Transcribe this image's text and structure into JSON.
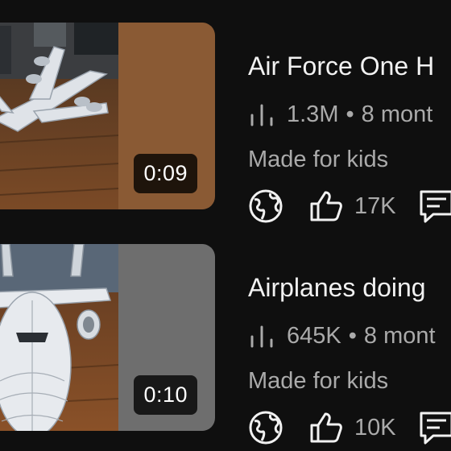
{
  "videos": [
    {
      "title": "Air Force One H",
      "duration": "0:09",
      "views": "1.3M",
      "separator": "•",
      "age": "8 mont",
      "badge": "Made for kids",
      "likes": "17K",
      "thumb_side_color": "#8a5a34"
    },
    {
      "title": "Airplanes doing",
      "duration": "0:10",
      "views": "645K",
      "separator": "•",
      "age": "8 mont",
      "badge": "Made for kids",
      "likes": "10K",
      "thumb_side_color": "#6e6e6e"
    }
  ],
  "icons": {
    "stats": "bar-chart-icon",
    "audience": "globe-icon",
    "like": "thumbs-up-icon",
    "comment": "comment-icon"
  },
  "colors": {
    "background": "#0f0f0f",
    "primary_text": "#f1f1f1",
    "secondary_text": "#aaaaaa"
  }
}
